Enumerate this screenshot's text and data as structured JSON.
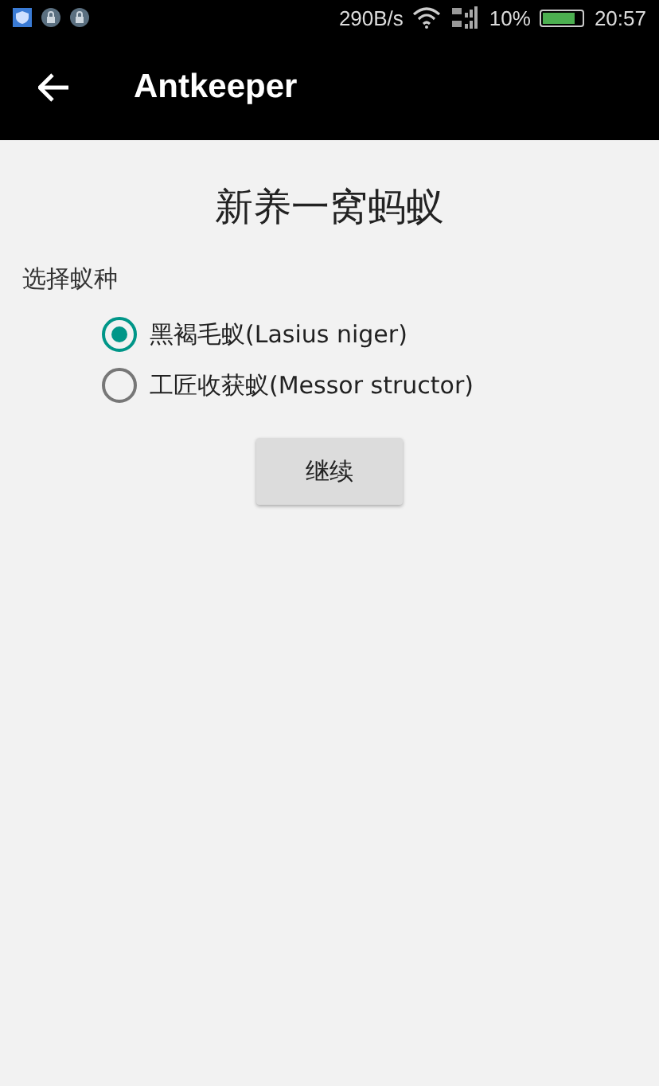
{
  "status_bar": {
    "speed": "290B/s",
    "battery_text": "10%",
    "time": "20:57"
  },
  "app_bar": {
    "title": "Antkeeper"
  },
  "heading": "新养一窝蚂蚁",
  "species_label": "选择蚁种",
  "options": [
    {
      "label": "黑褐毛蚁(Lasius niger)",
      "selected": true
    },
    {
      "label": "工匠收获蚁(Messor structor)",
      "selected": false
    }
  ],
  "button": "继续"
}
